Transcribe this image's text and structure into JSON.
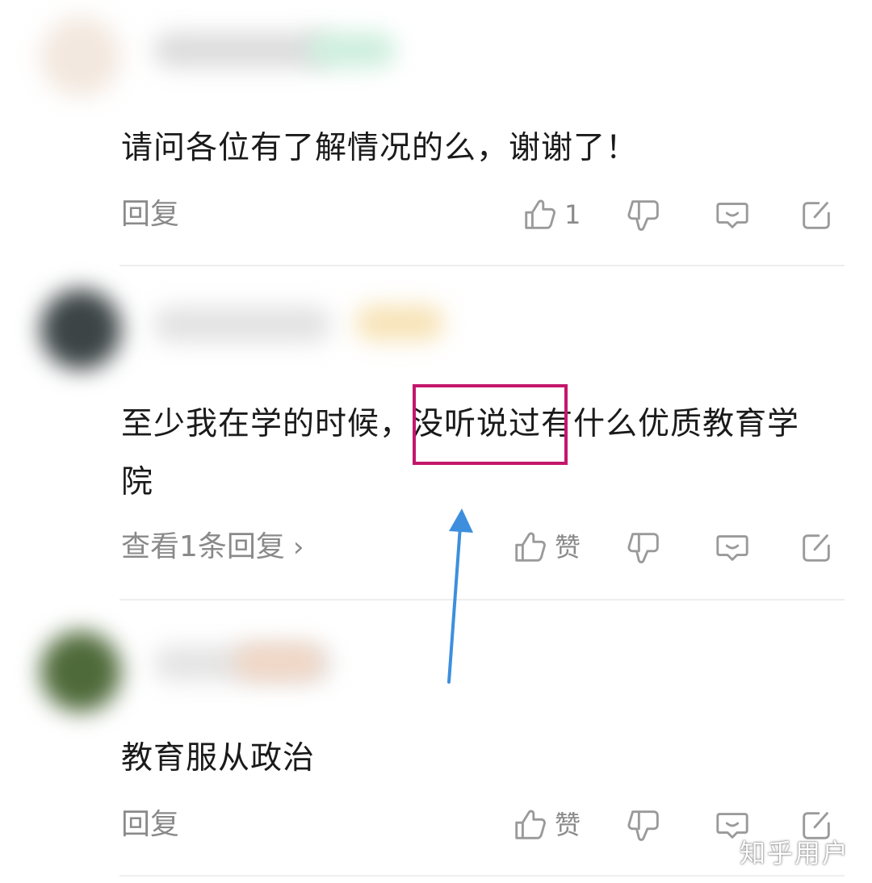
{
  "comments": [
    {
      "text": "请问各位有了解情况的么，谢谢了！",
      "reply_label": "回复",
      "like_count": "1"
    },
    {
      "text_line1": "至少我在学的时候，没听说过有什么优质教育学",
      "text_line2": "院",
      "reply_label": "查看1条回复",
      "reply_chevron": "›",
      "like_label": "赞"
    },
    {
      "text": "教育服从政治",
      "reply_label": "回复",
      "like_label": "赞"
    }
  ],
  "annotation": {
    "highlight_color": "#c4176c",
    "arrow_color": "#3d8fdd"
  },
  "icons": [
    "thumbs-up-icon",
    "thumbs-down-icon",
    "comment-icon",
    "share-icon"
  ],
  "watermark": "知乎用户"
}
